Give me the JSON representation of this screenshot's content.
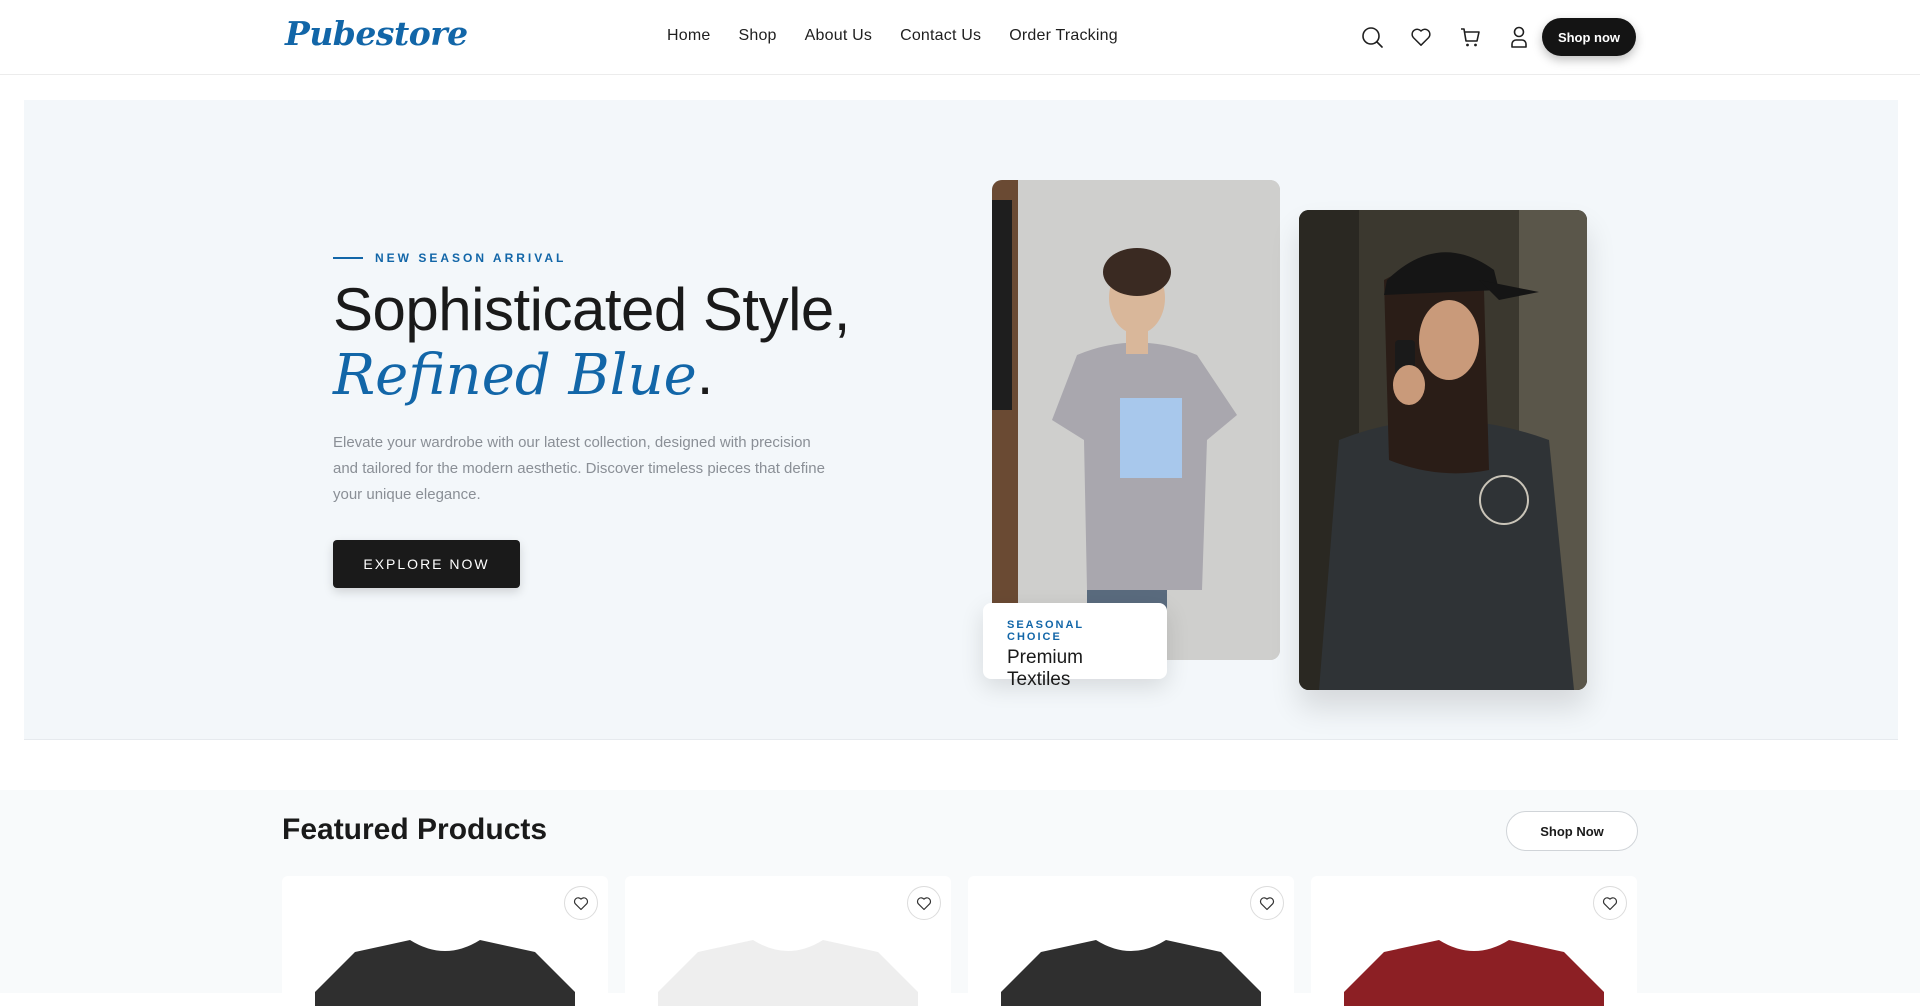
{
  "header": {
    "logo": "Pubestore",
    "nav": [
      "Home",
      "Shop",
      "About Us",
      "Contact Us",
      "Order Tracking"
    ],
    "icons": [
      "search-icon",
      "heart-icon",
      "cart-icon",
      "user-icon"
    ],
    "cta": "Shop now"
  },
  "hero": {
    "eyebrow": "NEW SEASON ARRIVAL",
    "title_line1": "Sophisticated Style,",
    "title_accent": "Refined Blue",
    "title_end": ".",
    "description": "Elevate your wardrobe with our latest collection, designed with precision and tailored for the modern aesthetic. Discover timeless pieces that define your unique elegance.",
    "button": "EXPLORE NOW",
    "badge_kicker": "SEASONAL CHOICE",
    "badge_title": "Premium Textiles"
  },
  "featured": {
    "title": "Featured Products",
    "button": "Shop Now",
    "products": [
      {
        "color": "#2f2f2f"
      },
      {
        "color": "#eeeeee"
      },
      {
        "color": "#2f2f2f"
      },
      {
        "color": "#8c1f24"
      }
    ]
  },
  "colors": {
    "accent": "#1266a8",
    "dark": "#141414",
    "hero_bg": "#f3f7fa"
  }
}
